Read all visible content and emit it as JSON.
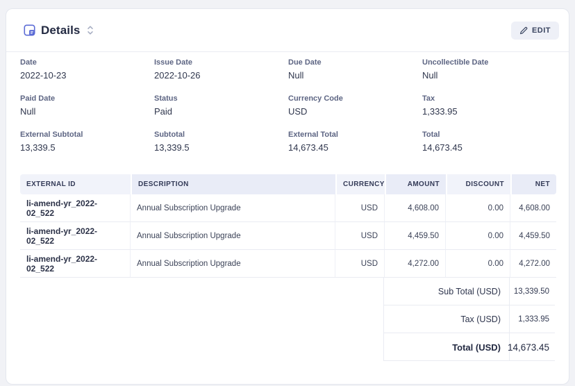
{
  "header": {
    "title": "Details",
    "edit_label": "EDIT"
  },
  "icons": {
    "title_icon": "note-icon",
    "collapse_icon": "sort-chevrons-icon",
    "edit_icon": "pencil-icon"
  },
  "fields": [
    {
      "label": "Date",
      "value": "2022-10-23"
    },
    {
      "label": "Issue Date",
      "value": "2022-10-26"
    },
    {
      "label": "Due Date",
      "value": "Null"
    },
    {
      "label": "Uncollectible Date",
      "value": "Null"
    },
    {
      "label": "Paid Date",
      "value": "Null"
    },
    {
      "label": "Status",
      "value": "Paid"
    },
    {
      "label": "Currency Code",
      "value": "USD"
    },
    {
      "label": "Tax",
      "value": "1,333.95"
    },
    {
      "label": "External Subtotal",
      "value": "13,339.5"
    },
    {
      "label": "Subtotal",
      "value": "13,339.5"
    },
    {
      "label": "External Total",
      "value": "14,673.45"
    },
    {
      "label": "Total",
      "value": "14,673.45"
    }
  ],
  "table": {
    "columns": [
      "EXTERNAL ID",
      "DESCRIPTION",
      "CURRENCY",
      "AMOUNT",
      "DISCOUNT",
      "NET"
    ],
    "rows": [
      [
        "li-amend-yr_2022-02_522",
        "Annual Subscription Upgrade",
        "USD",
        "4,608.00",
        "0.00",
        "4,608.00"
      ],
      [
        "li-amend-yr_2022-02_522",
        "Annual Subscription Upgrade",
        "USD",
        "4,459.50",
        "0.00",
        "4,459.50"
      ],
      [
        "li-amend-yr_2022-02_522",
        "Annual Subscription Upgrade",
        "USD",
        "4,272.00",
        "0.00",
        "4,272.00"
      ]
    ]
  },
  "summary": {
    "rows": [
      {
        "label": "Sub Total (USD)",
        "value": "13,339.50"
      },
      {
        "label": "Tax (USD)",
        "value": "1,333.95"
      },
      {
        "label": "Total (USD)",
        "value": "14,673.45"
      }
    ]
  },
  "colors": {
    "accent": "#5b6bd5",
    "page_bg": "#f1f2f6",
    "card_border": "#e4e7ee",
    "header_cell_light": "#f1f3fa",
    "header_cell_dark": "#e9ecf7",
    "edit_button_bg": "#eef0f7"
  }
}
